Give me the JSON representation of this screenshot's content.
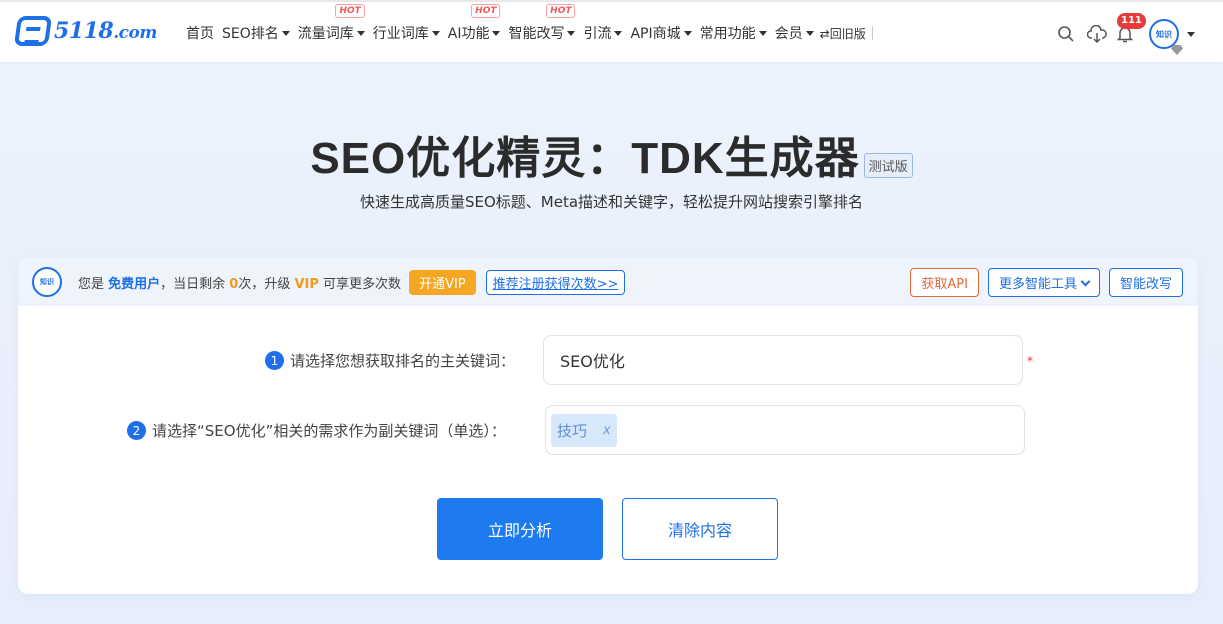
{
  "header": {
    "logo_main": "5118",
    "logo_suffix": ".com",
    "nav": [
      {
        "label": "首页",
        "caret": false,
        "hot": ""
      },
      {
        "label": "SEO排名",
        "caret": true,
        "hot": ""
      },
      {
        "label": "流量词库",
        "caret": true,
        "hot": "HOT"
      },
      {
        "label": "行业词库",
        "caret": true,
        "hot": ""
      },
      {
        "label": "AI功能",
        "caret": true,
        "hot": "HOT"
      },
      {
        "label": "智能改写",
        "caret": true,
        "hot": "HOT"
      },
      {
        "label": "引流",
        "caret": true,
        "hot": ""
      },
      {
        "label": "API商城",
        "caret": true,
        "hot": ""
      },
      {
        "label": "常用功能",
        "caret": true,
        "hot": ""
      },
      {
        "label": "会员",
        "caret": true,
        "hot": ""
      }
    ],
    "old_version": "⇄回旧版",
    "notification_count": "111",
    "avatar_text": "知识"
  },
  "hero": {
    "title": "SEO优化精灵：TDK生成器",
    "beta_label": "测试版",
    "subtitle": "快速生成高质量SEO标题、Meta描述和关键字，轻松提升网站搜索引擎排名"
  },
  "card": {
    "head": {
      "logo_text": "知识",
      "user_prefix": "您是 ",
      "user_type": "免费用户",
      "remain_prefix": "，当日剩余 ",
      "remain_count": "0",
      "remain_suffix": "次，升级 ",
      "vip_word": "VIP",
      "more_text": " 可享更多次数",
      "vip_button": "开通VIP",
      "register_link": "推荐注册获得次数>>",
      "api_button": "获取API",
      "more_tools_button": "更多智能工具",
      "rewrite_button": "智能改写"
    },
    "step1": {
      "num": "1",
      "label": "请选择您想获取排名的主关键词：",
      "value": "SEO优化"
    },
    "step2": {
      "num": "2",
      "label": "请选择“SEO优化”相关的需求作为副关键词（单选）：",
      "tag": "技巧",
      "tag_close": "x"
    },
    "analyze_button": "立即分析",
    "clear_button": "清除内容"
  },
  "colors": {
    "accent": "#1e6fe8",
    "vip": "#f5a623",
    "hot": "#f05a5a",
    "api": "#e0693a"
  }
}
